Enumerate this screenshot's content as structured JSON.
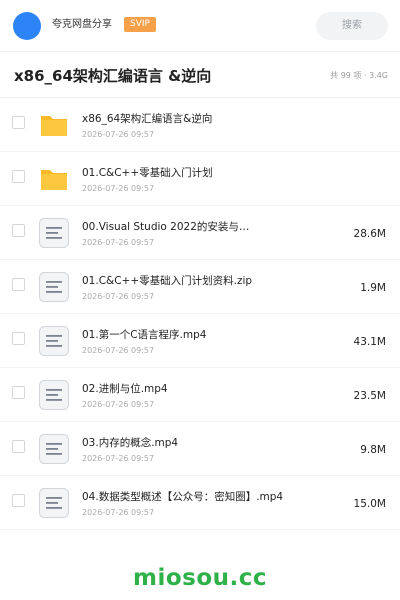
{
  "header": {
    "share_name": "夸克网盘分享",
    "badge": "SVIP",
    "search_label": "搜索",
    "avatar_color": "#2d84f6",
    "badge_color": "#f6a14a"
  },
  "folder": {
    "title": "x86_64架构汇编语言 &逆向",
    "summary": "共 99 项 · 3.4G"
  },
  "files": [
    {
      "type": "folder",
      "icon": "folder-icon",
      "name": "x86_64架构汇编语言&逆向",
      "date": "2026-07-26 09:57",
      "size": ""
    },
    {
      "type": "folder",
      "icon": "folder-icon",
      "name": "01.C&C++零基础入门计划",
      "date": "2026-07-26 09:57",
      "size": ""
    },
    {
      "type": "file",
      "icon": "document-icon",
      "name": "00.Visual Studio 2022的安装与…",
      "date": "2026-07-26 09:57",
      "size": "28.6M"
    },
    {
      "type": "file",
      "icon": "document-icon",
      "name": "01.C&C++零基础入门计划资料.zip",
      "date": "2026-07-26 09:57",
      "size": "1.9M"
    },
    {
      "type": "file",
      "icon": "document-icon",
      "name": "01.第一个C语言程序.mp4",
      "date": "2026-07-26 09:57",
      "size": "43.1M"
    },
    {
      "type": "file",
      "icon": "document-icon",
      "name": "02.进制与位.mp4",
      "date": "2026-07-26 09:57",
      "size": "23.5M"
    },
    {
      "type": "file",
      "icon": "document-icon",
      "name": "03.内存的概念.mp4",
      "date": "2026-07-26 09:57",
      "size": "9.8M"
    },
    {
      "type": "file",
      "icon": "document-icon",
      "name": "04.数据类型概述【公众号：密知圈】.mp4",
      "date": "2026-07-26 09:57",
      "size": "15.0M"
    }
  ],
  "watermark": "miosou.cc",
  "colors": {
    "folder": "#fcc93e",
    "watermark": "#2fb14a"
  }
}
